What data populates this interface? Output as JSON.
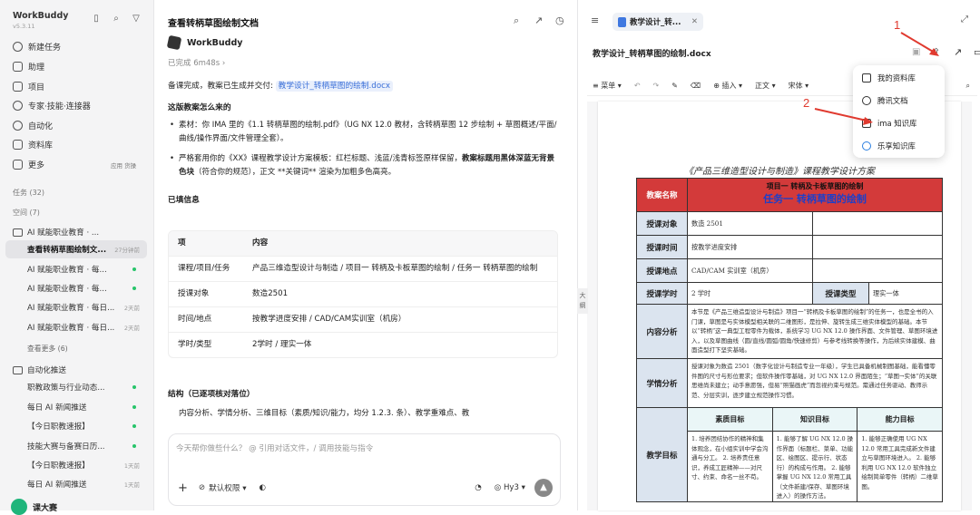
{
  "sidebar": {
    "brand": "WorkBuddy",
    "version": "v5.3.11",
    "nav": [
      "新建任务",
      "助理",
      "项目",
      "专家·技能·连接器",
      "自动化",
      "资料库",
      "更多"
    ],
    "more_tags": "应用 货操",
    "tasks_label": "任务 (32)",
    "space_label": "空间 (7)",
    "group1": "AI 赋能职业教育 · ...",
    "group1_items": [
      {
        "label": "查看转柄草图绘制文...",
        "time": "27分钟前",
        "active": true
      },
      {
        "label": "AI 赋能职业教育 · 每...",
        "time": "",
        "dot": true
      },
      {
        "label": "AI 赋能职业教育 · 每...",
        "time": "",
        "dot": true
      },
      {
        "label": "AI 赋能职业教育 · 每日...",
        "time": "2天前"
      },
      {
        "label": "AI 赋能职业教育 · 每日...",
        "time": "2天前"
      }
    ],
    "see_more": "查看更多 (6)",
    "group2": "自动化推送",
    "group2_items": [
      {
        "label": "职教政策与行业动态...",
        "time": "",
        "dot": true
      },
      {
        "label": "每日 AI 新闻推送",
        "time": "",
        "dot": true
      },
      {
        "label": "【今日职教速报】",
        "time": "",
        "dot": true
      },
      {
        "label": "技能大赛与备赛日历...",
        "time": "",
        "dot": true
      },
      {
        "label": "【今日职教速报】",
        "time": "1天前"
      },
      {
        "label": "每日 AI 新闻推送",
        "time": "1天前"
      }
    ],
    "user": "课大赛"
  },
  "chat": {
    "title": "查看转柄草图绘制文档",
    "agent": "WorkBuddy",
    "done": "已完成 6m48s",
    "intro": "备课完成，教案已生成并交付:",
    "file_link": "教学设计_转柄草图的绘制.docx",
    "sec1": "这版教案怎么来的",
    "b1_pre": "素材：你 IMA 里的《1.1 转柄草图的绘制.pdf》（UG NX 12.0 教材，含转柄草图 12 步绘制 + 草图概述/平面/曲线/操作界面/文件管理全套）。",
    "b2_pre": "严格套用你的《XX》课程教学设计方案模板：红栏标题、浅蓝/浅青标签原样保留，",
    "b2_bold": "教案标题用黑体深蓝无背景色块",
    "b2_post": "（符合你的规范），正文 **关键词** 渲染为加粗多色高亮。",
    "sec2": "已填信息",
    "table_head": [
      "项",
      "内容"
    ],
    "table": [
      [
        "课程/项目/任务",
        "产品三维造型设计与制造 / 项目一 转柄及卡板草图的绘制 / 任务一 转柄草图的绘制"
      ],
      [
        "授课对象",
        "数造2501"
      ],
      [
        "时间/地点",
        "按教学进度安排 / CAD/CAM实训室（机房）"
      ],
      [
        "学时/类型",
        "2学时 / 理实一体"
      ]
    ],
    "sec3": "结构（已逐项核对落位）",
    "b3": "内容分析、学情分析、三维目标（素质/知识/能力，均分 1.2.3. 条）、教学重难点、教",
    "placeholder": "今天帮你做些什么？ @ 引用对话文件，/ 调用技能与指令",
    "perm": "默认权限",
    "model": "Hy3"
  },
  "preview": {
    "tab": "教学设计_转...",
    "filename": "教学设计_转柄草图的绘制.docx",
    "toolbar": [
      "菜单",
      "正文",
      "宋体",
      "插入"
    ],
    "side_tab": "大纲",
    "doc_title": "《产品三维造型设计与制造》课程教学设计方案",
    "row_title_label": "教案名称",
    "row_title_1": "项目一 转柄及卡板草图的绘制",
    "row_title_2": "任务一 转柄草图的绘制",
    "r1_label": "授课对象",
    "r1_val": "数造 2501",
    "r2_label": "授课时间",
    "r2_val": "按教学进度安排",
    "r3_label": "授课地点",
    "r3_val": "CAD/CAM 实训室（机房）",
    "r4_label": "授课学时",
    "r4_val": "2 学时",
    "r4_label2": "授课类型",
    "r4_val2": "理实一体",
    "r5_label": "内容分析",
    "r5_val": "本节是《产品三维造型设计与制造》项目一“转柄及卡板草图的绘制”的任务一，也是全书的入门课，草图是与实体模型相关联的二维图形，是拉伸、旋转生成三维实体模型的基础。本节以“转柄”这一典型工程零件为载体，系统学习 UG NX 12.0 操作界面、文件管理、草图环境进入，以及草图曲线（圆/直线/圆弧/圆角/快速修剪）与参考线转换等操作，为后续实体建模、曲面造型打下坚实基础。",
    "r6_label": "学情分析",
    "r6_val": "授课对象为数造 2501（数字化设计与制造专业一年级），学生已具备机械制图基础，能看懂零件图的尺寸与形位要求；但软件操作零基础，对 UG NX 12.0 界面陌生；“草图→实体”的关联思维尚未建立；动手意愿强，但易“照猫画虎”而忽视约束与规范。需通过任务驱动、教师示范、分层实训，逐步建立规范操作习惯。",
    "goal_heads": [
      "素质目标",
      "知识目标",
      "能力目标"
    ],
    "r7_label": "教学目标",
    "goal_1": "1. 培养团结协作的精神和集体观念，在小组实训中学会沟通与分工。 2. 培养责任意识，养成工匠精神——对尺寸、约束、命名一丝不苟。",
    "goal_2": "1. 能够了解 UG NX 12.0 操作界面（标题栏、菜单、功能区、绘图区、提示行、状态行）的构成与作用。 2. 能够掌握 UG NX 12.0 常用工具（文件新建/保存、草图环境进入）的操作方法。",
    "goal_3": "1. 能够正确使用 UG NX 12.0 常用工具完成新文件建立与草图环境进入。 2. 能够利用 UG NX 12.0 软件独立绘制简单零件（转柄）二维草图。",
    "menu": [
      "我的资料库",
      "腾讯文档",
      "ima 知识库",
      "乐享知识库"
    ]
  },
  "annotations": [
    "1",
    "2"
  ],
  "colors": {
    "accent": "#3a6fd8",
    "arrow": "#e03a2f",
    "title_red": "#d33a3a",
    "label_blue": "#dbe4ef"
  }
}
